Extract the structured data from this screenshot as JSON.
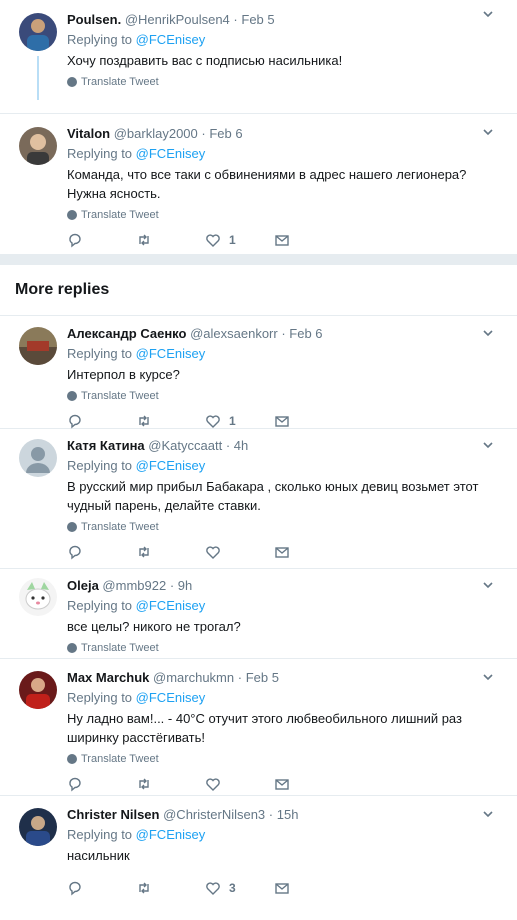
{
  "tweets_top": [
    {
      "name": "Poulsen.",
      "handle": "@HenrikPoulsen4",
      "time": "Feb 5",
      "replying_label": "Replying to",
      "replying_to": "@FCEnisey",
      "text": "Хочу поздравить вас с подписью насильника!",
      "translate": "Translate Tweet"
    },
    {
      "name": "Vitalon",
      "handle": "@barklay2000",
      "time": "Feb 6",
      "replying_label": "Replying to",
      "replying_to": "@FCEnisey",
      "text": "Команда, что все таки с обвинениями в адрес нашего легионера? Нужна ясность.",
      "translate": "Translate Tweet",
      "likes": "1"
    }
  ],
  "more_replies_title": "More replies",
  "tweets_more": [
    {
      "name": "Александр Саенко",
      "handle": "@alexsaenkorr",
      "time": "Feb 6",
      "replying_label": "Replying to",
      "replying_to": "@FCEnisey",
      "text": "Интерпол в курсе?",
      "translate": "Translate Tweet",
      "likes": "1"
    },
    {
      "name": "Катя Катина",
      "handle": "@Katyccaatt",
      "time": "4h",
      "replying_label": "Replying to",
      "replying_to": "@FCEnisey",
      "text": "В русский мир прибыл Бабакара , сколько юных девиц возьмет этот чудный парень, делайте ставки.",
      "translate": "Translate Tweet",
      "likes": ""
    },
    {
      "name": "Oleja",
      "handle": "@mmb922",
      "time": "9h",
      "replying_label": "Replying to",
      "replying_to": "@FCEnisey",
      "text": "все целы? никого не трогал?",
      "translate": "Translate Tweet"
    },
    {
      "name": "Max Marchuk",
      "handle": "@marchukmn",
      "time": "Feb 5",
      "replying_label": "Replying to",
      "replying_to": "@FCEnisey",
      "text": "Ну ладно вам!...   - 40°C отучит этого любвеобильного лишний раз ширинку расстёгивать!",
      "translate": "Translate Tweet",
      "likes": ""
    },
    {
      "name": "Christer Nilsen",
      "handle": "@ChristerNilsen3",
      "time": "15h",
      "replying_label": "Replying to",
      "replying_to": "@FCEnisey",
      "text": "насильник",
      "likes": "3"
    }
  ],
  "icons": {
    "reply": "reply-icon",
    "retweet": "retweet-icon",
    "like": "heart-icon",
    "message": "direct-message-icon",
    "more": "chevron-down-icon",
    "translate": "globe-icon"
  },
  "colors": {
    "link": "#1da1f2",
    "muted": "#657786",
    "divider": "#e6ecf0",
    "thread": "#b9def6"
  }
}
